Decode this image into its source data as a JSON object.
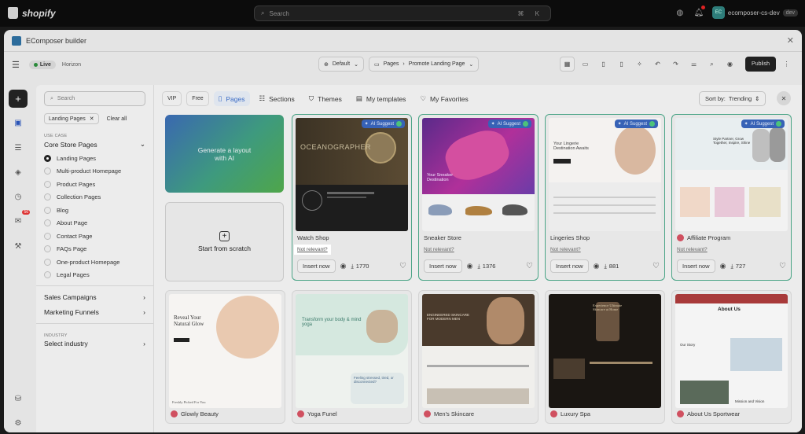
{
  "shopify": {
    "brand": "shopify",
    "search_placeholder": "Search",
    "shortcut": "⌘ K",
    "store_initials": "EC",
    "store_name": "ecomposer-cs-dev",
    "store_badge": "dev"
  },
  "modal": {
    "title": "EComposer builder"
  },
  "toolbar": {
    "live": "Live",
    "theme": "Horizon",
    "page_select": "Default",
    "pages_label": "Pages",
    "page_name": "Promote Landing Page",
    "publish": "Publish"
  },
  "sidenav": {
    "badge": "56"
  },
  "filters": {
    "search_placeholder": "Search",
    "chip": "Landing Pages",
    "clear_all": "Clear all",
    "use_case_hdr": "USE CASE",
    "core_title": "Core Store Pages",
    "items": [
      "Landing Pages",
      "Multi-product Homepage",
      "Product Pages",
      "Collection Pages",
      "Blog",
      "About Page",
      "Contact Page",
      "FAQs Page",
      "One-product Homepage",
      "Legal Pages"
    ],
    "sales": "Sales Campaigns",
    "marketing": "Marketing Funnels",
    "industry_hdr": "INDUSTRY",
    "industry": "Select industry"
  },
  "tabs": {
    "vip": "VIP",
    "free": "Free",
    "pages": "Pages",
    "sections": "Sections",
    "themes": "Themes",
    "templates": "My templates",
    "favorites": "My Favorites"
  },
  "sort": {
    "label": "Sort by:",
    "value": "Trending"
  },
  "generate": "Generate a layout with AI",
  "scratch": "Start from scratch",
  "ai_suggest": "AI Suggest",
  "not_relevant": "Not relevant?",
  "insert": "Insert now",
  "cards": [
    {
      "name": "Watch Shop",
      "downloads": "1770"
    },
    {
      "name": "Sneaker Store",
      "downloads": "1376"
    },
    {
      "name": "Lingeries Shop",
      "downloads": "881"
    },
    {
      "name": "Affiliate Program",
      "downloads": "727"
    }
  ],
  "bottom_cards": [
    "Glowly Beauty",
    "Yoga Funel",
    "Men's Skincare",
    "Luxury Spa",
    "About Us Sportwear"
  ],
  "thumb_text": {
    "watch": "OCEANOGRAPHER",
    "sneaker": "Your Sneaker Destination",
    "lingerie": "Your Lingerie Destination Awaits",
    "affiliate": "Style Partner, Grow Together, Inspire, Shine",
    "beauty": "Reveal Your Natural Glow",
    "yoga": "Transform your body & mind yoga",
    "yoga2": "Feeling stressed, tired, or disconnected?",
    "skincare": "ENGINEERED SKINCARE FOR MODERN MEN",
    "spa": "Experience Ultimate Skincare at Home",
    "about": "About Us",
    "story": "Our Story",
    "mission": "Mission and Vision",
    "beauty_sub": "Freshly Picked For You"
  }
}
